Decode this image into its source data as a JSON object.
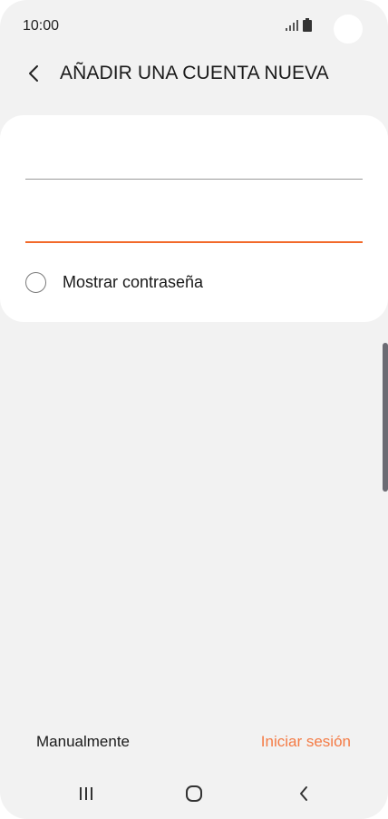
{
  "status_bar": {
    "time": "10:00",
    "icons": [
      "signal-icon",
      "battery-icon"
    ]
  },
  "header": {
    "back_icon": "chevron-left-icon",
    "title": "AÑADIR UNA CUENTA NUEVA"
  },
  "form": {
    "email_value": "",
    "password_value": "",
    "show_password_label": "Mostrar contraseña",
    "show_password_checked": false,
    "accent_color": "#f26a2a"
  },
  "actions": {
    "manual_label": "Manualmente",
    "signin_label": "Iniciar sesión",
    "signin_color": "#f47b45"
  },
  "nav_bar": {
    "icons": [
      "recent-apps-icon",
      "home-icon",
      "back-icon"
    ]
  }
}
